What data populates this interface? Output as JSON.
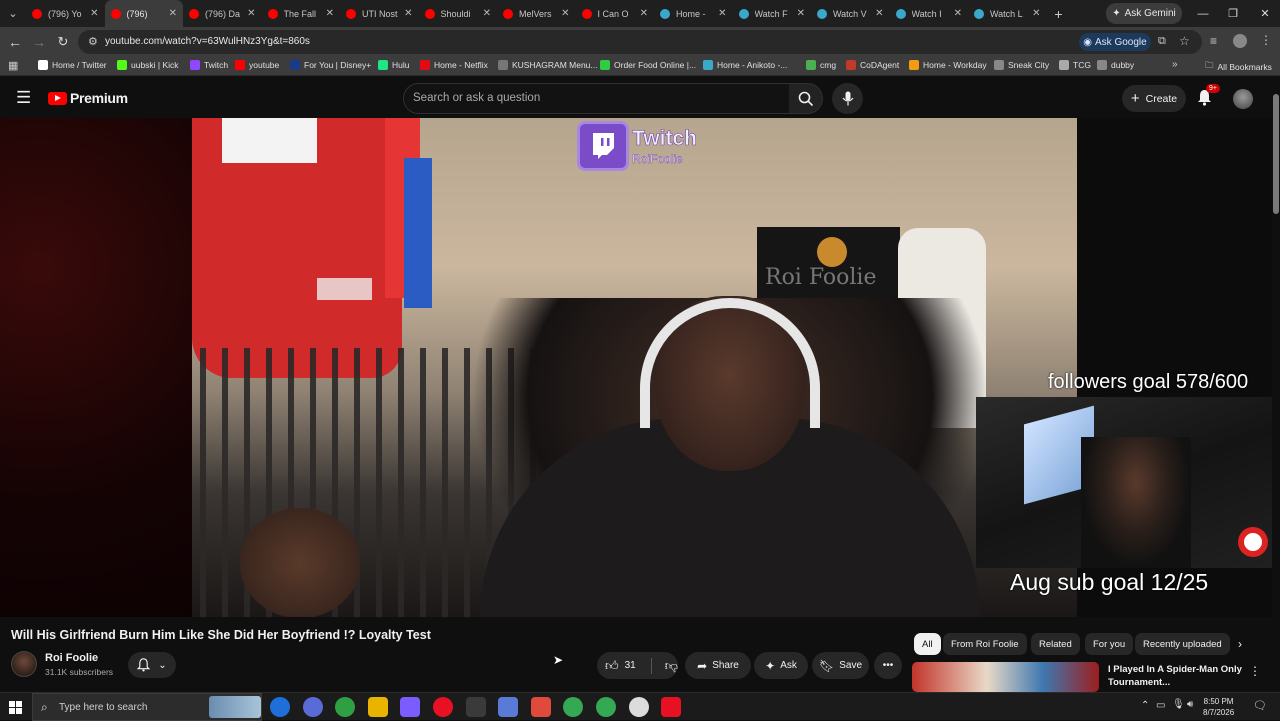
{
  "browser": {
    "tabs": [
      {
        "title": "(796) Yo",
        "color": "#ff0000"
      },
      {
        "title": "(796)",
        "color": "#ff0000",
        "active": true
      },
      {
        "title": "(796) Da",
        "color": "#ff0000"
      },
      {
        "title": "The Fall",
        "color": "#ff0000"
      },
      {
        "title": "UTI Nost",
        "color": "#ff0000"
      },
      {
        "title": "Shouldi",
        "color": "#ff0000"
      },
      {
        "title": "MelVers",
        "color": "#ff0000"
      },
      {
        "title": "I Can O",
        "color": "#ff0000"
      },
      {
        "title": "Home -",
        "color": "#3aa8c8"
      },
      {
        "title": "Watch F",
        "color": "#3aa8c8"
      },
      {
        "title": "Watch V",
        "color": "#3aa8c8"
      },
      {
        "title": "Watch I",
        "color": "#3aa8c8"
      },
      {
        "title": "Watch L",
        "color": "#3aa8c8"
      }
    ],
    "ask_gemini": "Ask Gemini",
    "url": "youtube.com/watch?v=63WulHNz3Yg&t=860s",
    "ask_google": "Ask Google",
    "bookmarks": [
      {
        "label": "Home / Twitter",
        "color": "#ffffff"
      },
      {
        "label": "uubski | Kick",
        "color": "#53fc18"
      },
      {
        "label": "Twitch",
        "color": "#9146ff"
      },
      {
        "label": "youtube",
        "color": "#ff0000"
      },
      {
        "label": "For You | Disney+",
        "color": "#1a3a8a"
      },
      {
        "label": "Hulu",
        "color": "#1ce783"
      },
      {
        "label": "Home - Netflix",
        "color": "#e50914"
      },
      {
        "label": "KUSHAGRAM Menu...",
        "color": "#777777"
      },
      {
        "label": "Order Food Online |...",
        "color": "#2ecc40"
      },
      {
        "label": "Home - Anikoto -...",
        "color": "#3aa8c8"
      },
      {
        "label": "cmg",
        "color": "#4caf50"
      },
      {
        "label": "CoDAgent",
        "color": "#c0392b"
      },
      {
        "label": "Home - Workday",
        "color": "#f39c12"
      },
      {
        "label": "Sneak City",
        "color": "#888888"
      },
      {
        "label": "TCG",
        "color": "#aaaaaa"
      },
      {
        "label": "dubby",
        "color": "#888888"
      }
    ],
    "all_bookmarks": "All Bookmarks"
  },
  "youtube": {
    "logo_text": "Premium",
    "search_placeholder": "Search or ask a question",
    "create_label": "Create",
    "notif_badge": "9+",
    "video_overlay": {
      "twitch_brand": "Twitch",
      "twitch_user": "RoiFoolie",
      "followers_goal": "followers goal 578/600",
      "sub_goal": "Aug sub goal 12/25",
      "flag_text": "Roi Foolie"
    },
    "video_title": "Will His Girlfriend Burn Him Like She Did Her Boyfriend !? Loyalty Test",
    "channel_name": "Roi Foolie",
    "subscribers": "31.1K subscribers",
    "likes": "31",
    "share_label": "Share",
    "ask_label": "Ask",
    "save_label": "Save",
    "chips": [
      "All",
      "From Roi Foolie",
      "Related",
      "For you",
      "Recently uploaded"
    ],
    "recommended": {
      "title": "I Played In A Spider-Man Only Tournament..."
    }
  },
  "taskbar": {
    "search_placeholder": "Type here to search",
    "time": "8:50 PM",
    "date": "8/7/2026"
  }
}
